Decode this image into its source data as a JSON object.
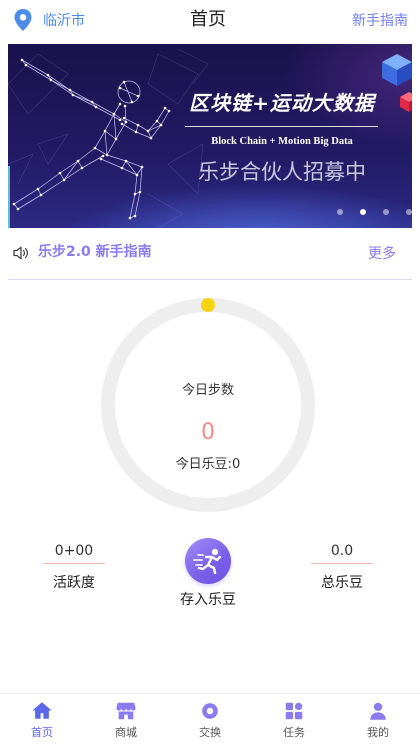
{
  "colors": {
    "brand_blue": "#4a8ce8",
    "guide_link": "#6e80f1",
    "accent_purple": "#8b7bf1",
    "active_tab": "#5b67ea",
    "ring": "#eeeeee",
    "progress_dot": "#f7d30d",
    "step_value": "#f28c8c",
    "underline": "#f5b6b6"
  },
  "header": {
    "location_icon": "location-pin-icon",
    "city": "临沂市",
    "title": "首页",
    "guide_link": "新手指南"
  },
  "banner": {
    "headline": "区块链+运动大数据",
    "subline": "Block Chain + Motion Big Data",
    "tagline": "乐步合伙人招募中",
    "slide_count": 4,
    "active_slide": 1
  },
  "notice": {
    "icon": "speaker-icon",
    "title": "乐步2.0 新手指南",
    "more": "更多"
  },
  "steps": {
    "label": "今日步数",
    "value": "0",
    "beans": "今日乐豆:0",
    "progress": 0
  },
  "stats": {
    "activity": {
      "value": "0+00",
      "label": "活跃度"
    },
    "deposit": {
      "icon": "running-man-icon",
      "label": "存入乐豆"
    },
    "total_beans": {
      "value": "0.0",
      "label": "总乐豆"
    }
  },
  "tabbar": {
    "items": [
      {
        "label": "首页",
        "icon": "home-icon",
        "active": true
      },
      {
        "label": "商城",
        "icon": "store-icon",
        "active": false
      },
      {
        "label": "交换",
        "icon": "exchange-icon",
        "active": false
      },
      {
        "label": "任务",
        "icon": "tasks-icon",
        "active": false
      },
      {
        "label": "我的",
        "icon": "profile-icon",
        "active": false
      }
    ]
  }
}
